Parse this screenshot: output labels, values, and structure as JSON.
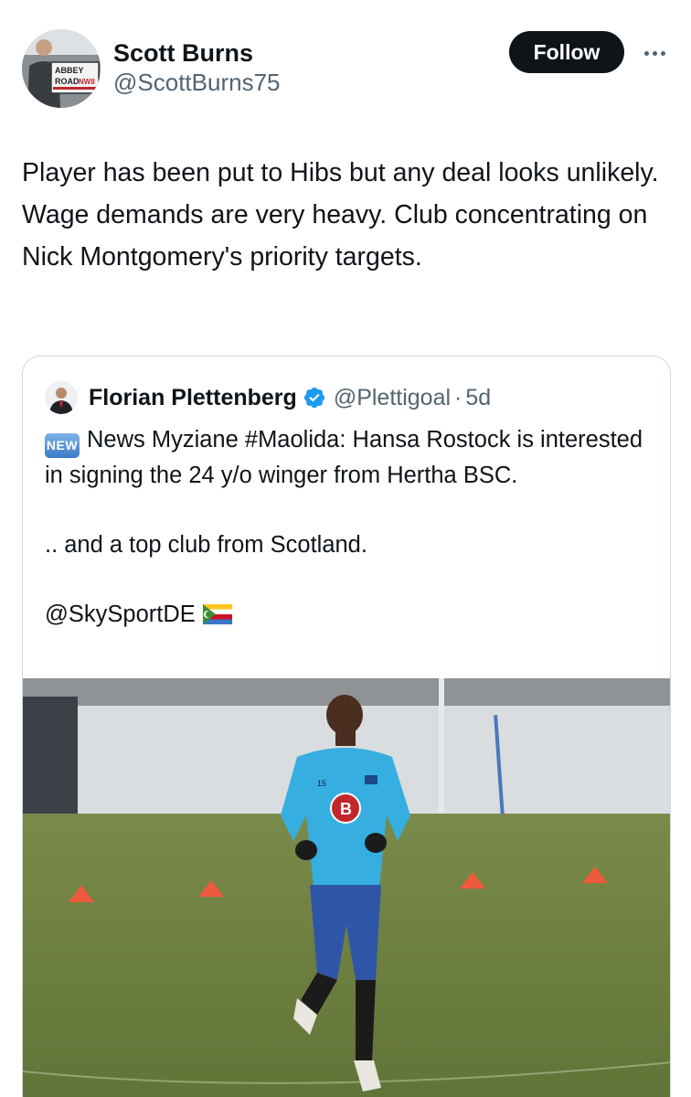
{
  "author": {
    "display_name": "Scott Burns",
    "handle": "@ScottBurns75",
    "avatar_sign_line1": "ABBEY",
    "avatar_sign_line2": "ROAD",
    "avatar_sign_line3": "NW8"
  },
  "actions": {
    "follow_label": "Follow",
    "more_icon": "more-horizontal-icon"
  },
  "tweet": {
    "text": "Player has been put to Hibs but any deal looks unlikely.  Wage demands are very heavy.  Club concentrating  on Nick Montgomery's priority targets."
  },
  "quoted": {
    "display_name": "Florian Plettenberg",
    "verified_icon": "verified-badge-icon",
    "handle": "@Plettigoal",
    "separator": "·",
    "time": "5d",
    "badge": "NEW",
    "line1": "News Myziane #Maolida: Hansa Rostock is interested in signing the 24 y/o winger from Hertha BSC.",
    "line2": ".. and a top club from Scotland.",
    "line3": "@SkySportDE",
    "flag_icon": "comoros-flag-icon",
    "photo": {
      "shirt_number": "15",
      "shirt_logo": "B"
    }
  },
  "colors": {
    "text": "#0f1419",
    "secondary": "#536471",
    "border": "#cfd9de",
    "verified": "#1d9bf0",
    "follow_bg": "#0f1419"
  }
}
